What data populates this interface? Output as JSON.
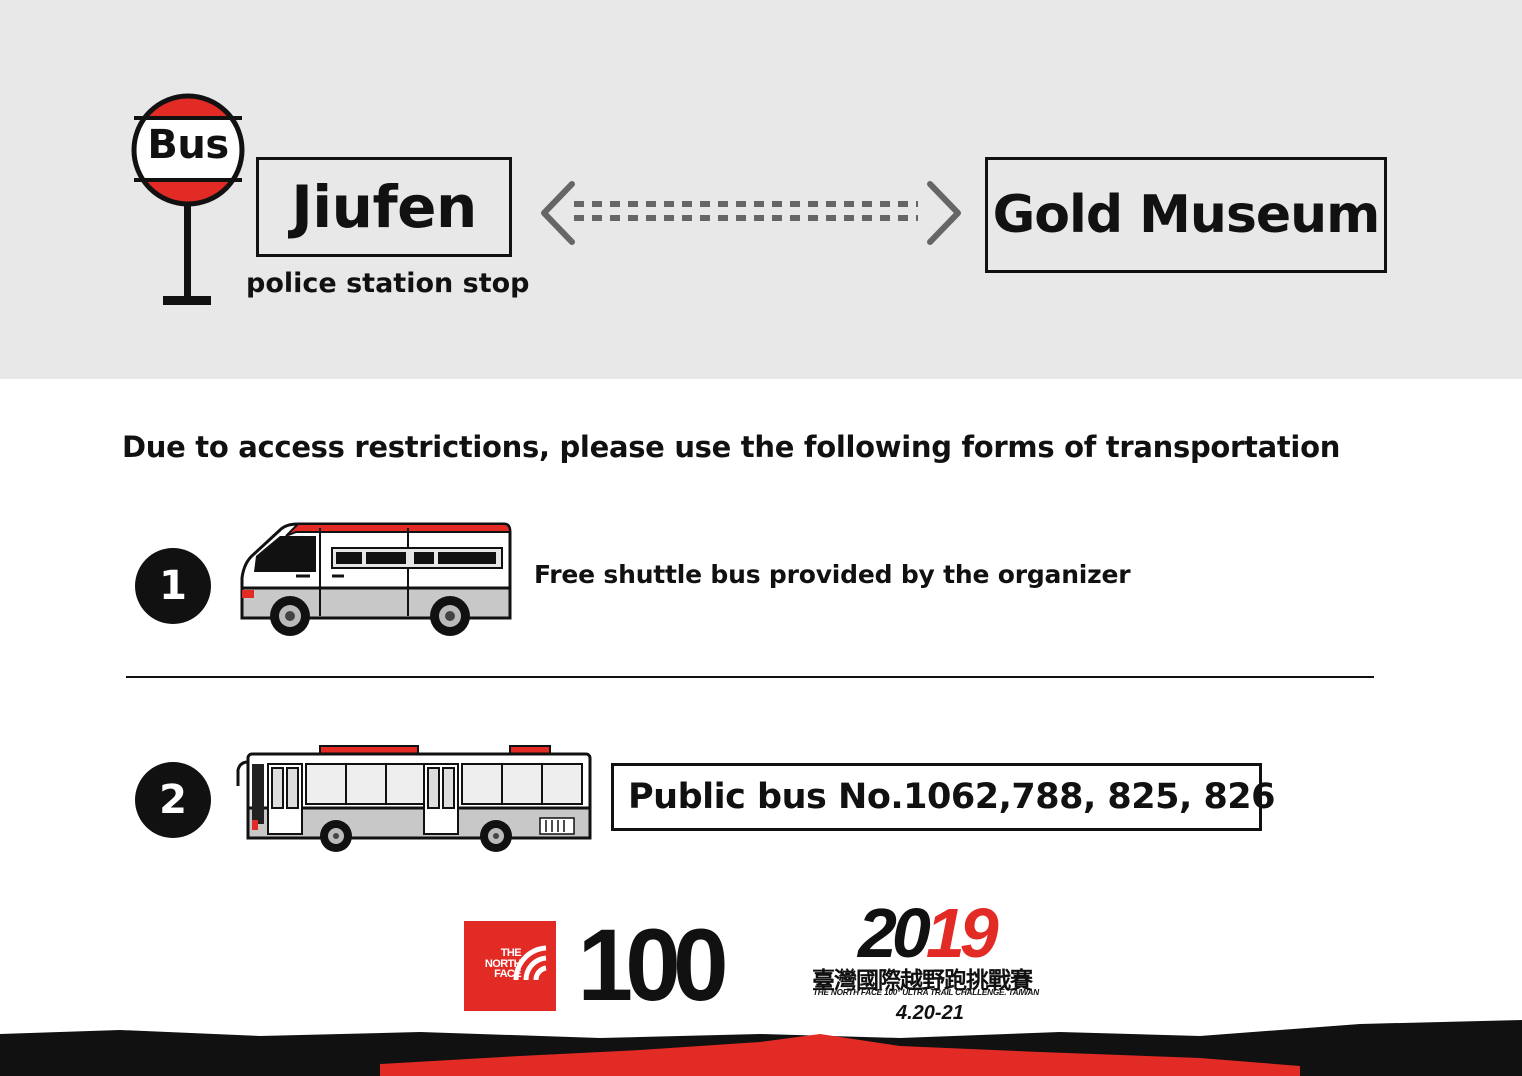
{
  "route": {
    "sign_label": "Bus",
    "origin": "Jiufen",
    "origin_stop": "police station stop",
    "destination": "Gold Museum"
  },
  "notice": "Due to access restrictions, please use the following forms of transportation",
  "options": [
    {
      "number": "1",
      "description": "Free shuttle bus provided by the organizer"
    },
    {
      "number": "2",
      "description": "Public bus No.1062,788, 825, 826"
    }
  ],
  "logos": {
    "brand": [
      "THE",
      "NORTH",
      "FACE"
    ],
    "hundred": "100",
    "year_prefix": "20",
    "year_suffix": "19",
    "event_name_zh": "臺灣國際越野跑挑戰賽",
    "event_name_en": "THE NORTH FACE 100° ULTRA TRAIL CHALLENGE. TAIWAN",
    "dates": "4.20-21"
  },
  "colors": {
    "accent_red": "#e32b26",
    "background_gray": "#e8e8e8",
    "ink": "#111111"
  }
}
